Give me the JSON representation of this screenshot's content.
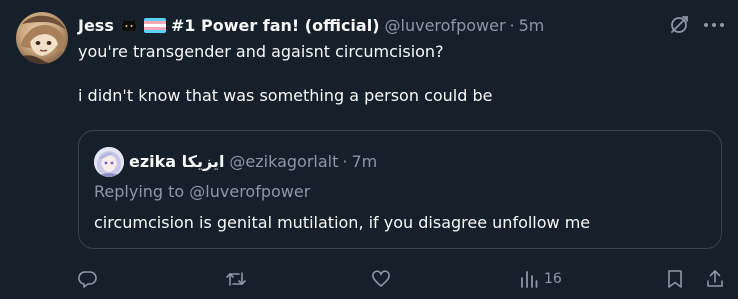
{
  "author": {
    "display_name": "Jess",
    "name_suffix": "#1 Power fan! (official)",
    "emoji": [
      "black-cat-emoji",
      "transgender-flag-emoji"
    ],
    "handle": "@luverofpower",
    "separator": "·",
    "time": "5m"
  },
  "post": {
    "lines": [
      "you're transgender and agaisnt circumcision?",
      "i didn't know that was something a person could be"
    ]
  },
  "quoted_post": {
    "display_name": "ezika ايزيكا",
    "handle": "@ezikagorlalt",
    "separator": "·",
    "time": "7m",
    "reply_context": "Replying to @luverofpower",
    "text": "circumcision is genital mutilation, if you disagree unfollow me"
  },
  "actions": {
    "reply_icon": "reply-icon",
    "repost_icon": "repost-icon",
    "like_icon": "like-icon",
    "views_icon": "views-icon",
    "views_count": "16",
    "bookmark_icon": "bookmark-icon",
    "share_icon": "share-icon"
  },
  "colors": {
    "background": "#15202b",
    "text_primary": "#f7f9f9",
    "text_secondary": "#8b98a5",
    "border": "#38444d"
  }
}
